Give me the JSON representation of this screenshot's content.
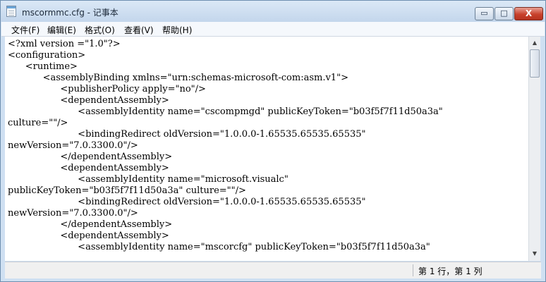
{
  "window": {
    "title": "mscormmc.cfg - 记事本",
    "icon": "notepad-icon"
  },
  "controls": {
    "minimize": "▭",
    "maximize": "□",
    "close": "X"
  },
  "menu": [
    "文件(F)",
    "编辑(E)",
    "格式(O)",
    "查看(V)",
    "帮助(H)"
  ],
  "editor": {
    "lines": [
      "<?xml version =\"1.0\"?>",
      "<configuration>",
      "      <runtime>",
      "            <assemblyBinding xmlns=\"urn:schemas-microsoft-com:asm.v1\">",
      "                  <publisherPolicy apply=\"no\"/>",
      "                  <dependentAssembly>",
      "                        <assemblyIdentity name=\"cscompmgd\" publicKeyToken=\"b03f5f7f11d50a3a\"",
      "culture=\"\"/>",
      "                        <bindingRedirect oldVersion=\"1.0.0.0-1.65535.65535.65535\"",
      "newVersion=\"7.0.3300.0\"/>",
      "                  </dependentAssembly>",
      "                  <dependentAssembly>",
      "                        <assemblyIdentity name=\"microsoft.visualc\"",
      "publicKeyToken=\"b03f5f7f11d50a3a\" culture=\"\"/>",
      "                        <bindingRedirect oldVersion=\"1.0.0.0-1.65535.65535.65535\"",
      "newVersion=\"7.0.3300.0\"/>",
      "                  </dependentAssembly>",
      "                  <dependentAssembly>",
      "                        <assemblyIdentity name=\"mscorcfg\" publicKeyToken=\"b03f5f7f11d50a3a\""
    ]
  },
  "scrollbar": {
    "up": "▲",
    "down": "▼"
  },
  "status": {
    "position": "第 1 行，第 1 列"
  }
}
